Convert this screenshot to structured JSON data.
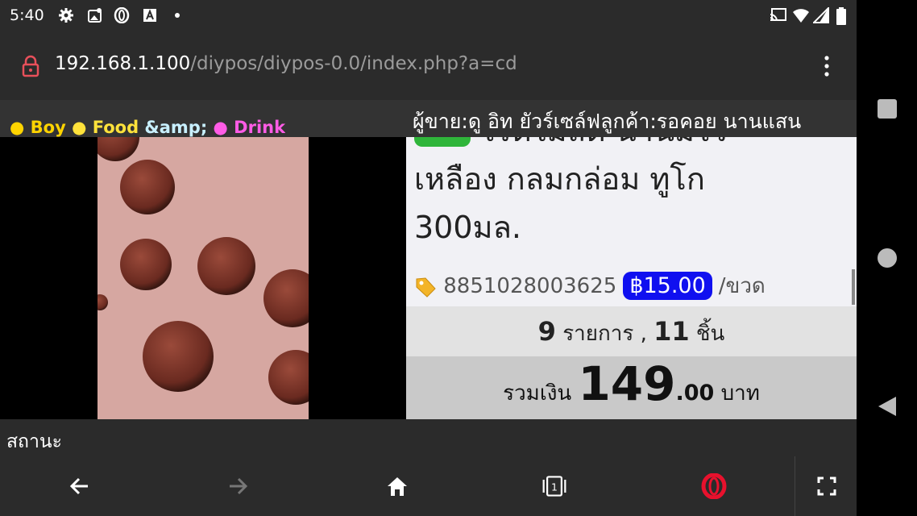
{
  "status_bar": {
    "time": "5:40"
  },
  "browser": {
    "url_host": "192.168.1.100",
    "url_path": "/diypos/diypos-0.0/index.php?a=cd",
    "status_label": "สถานะ"
  },
  "pos": {
    "shop_name_parts": [
      "Boy ",
      "Food ",
      "&amp; ",
      "Drink"
    ],
    "seller_customer": "ผู้ขาย:ดู อิท ยัวร์เซล์ฟลูกค้า:รอคอย นานแสน",
    "product": {
      "name_line1": "โรตี้ไมลด์ นานมีไว",
      "name_line2": "เหลือง กลมกล่อม ทูโก",
      "name_line3": "300มล.",
      "barcode": "8851028003625",
      "price": "฿15.00",
      "unit": "/ขวด"
    },
    "summary": {
      "items_count": "9",
      "items_label": "รายการ ,",
      "pieces_count": "11",
      "pieces_label": "ชิ้น",
      "total_label": "รวมเงิน",
      "total_int": "149",
      "total_dec": ".00",
      "currency": "บาท"
    }
  },
  "colors": {
    "price_badge": "#1010f0",
    "chrome": "#2b2b2b",
    "opera_red": "#e8112d"
  },
  "icons": [
    "settings-icon",
    "photos-icon",
    "opera-icon",
    "a-icon",
    "dot-icon",
    "cast-icon",
    "wifi-icon",
    "signal-icon",
    "battery-icon",
    "lock-icon",
    "more-icon",
    "tag-icon",
    "back-icon",
    "forward-icon",
    "home-icon",
    "tabs-icon",
    "opera-menu-icon",
    "fullscreen-icon",
    "recents-icon",
    "home-circle-icon",
    "back-triangle-icon"
  ]
}
